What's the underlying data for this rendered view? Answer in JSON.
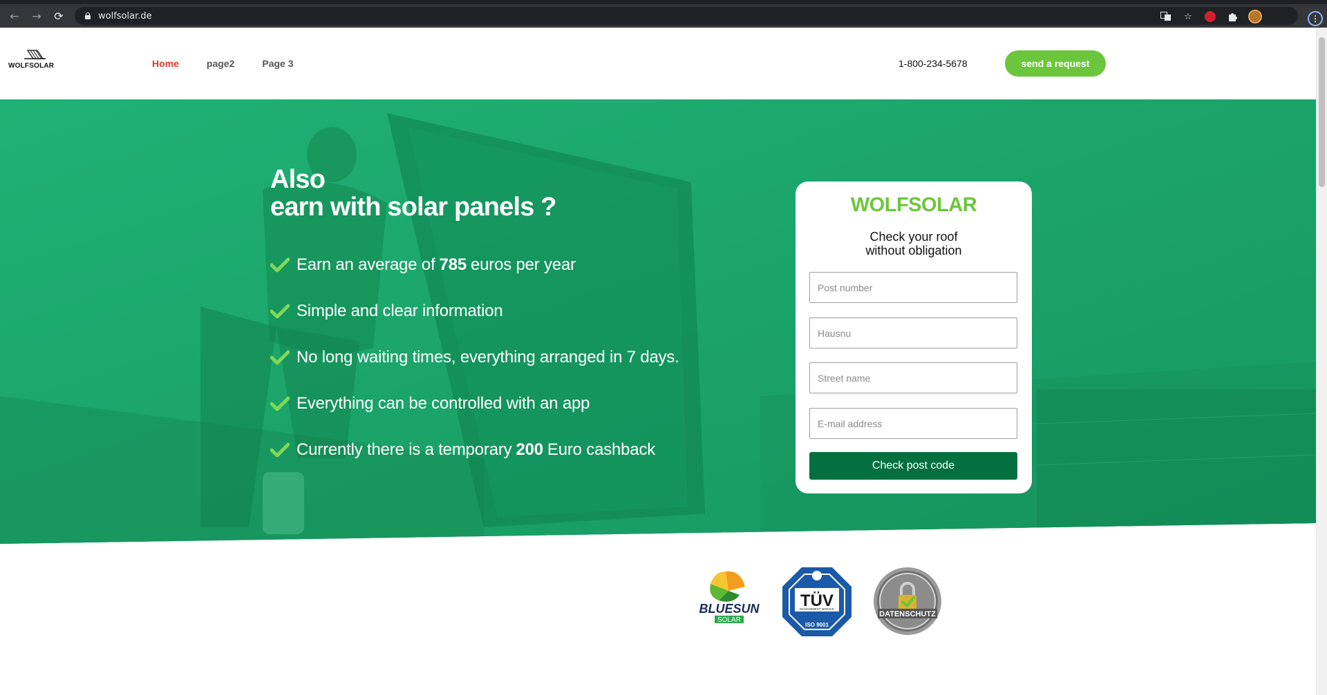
{
  "browser": {
    "url": "wolfsolar.de",
    "icons": [
      "back-arrow-icon",
      "forward-arrow-icon",
      "reload-icon",
      "lock-icon",
      "translate-icon",
      "star-icon",
      "extension-icon",
      "puzzle-icon",
      "profile-avatar",
      "menu-icon"
    ]
  },
  "header": {
    "logo_text": "WOLFSOLAR",
    "nav": [
      {
        "label": "Home",
        "active": true
      },
      {
        "label": "page2",
        "active": false
      },
      {
        "label": "Page 3",
        "active": false
      }
    ],
    "phone": "1-800-234-5678",
    "cta_label": "send a request"
  },
  "hero": {
    "title_line1": "Also",
    "title_line2": "earn with solar panels ?",
    "features": [
      {
        "pre": "Earn an average of",
        "bold": "785",
        "post": "euros per year"
      },
      {
        "pre": "Simple and clear information",
        "bold": "",
        "post": ""
      },
      {
        "pre": "No long waiting times, everything arranged in 7 days.",
        "bold": "",
        "post": ""
      },
      {
        "pre": "Everything can be controlled with an app",
        "bold": "",
        "post": ""
      },
      {
        "pre": "Currently there is a temporary",
        "bold": "200",
        "post": "Euro cashback"
      }
    ]
  },
  "form": {
    "brand": "WOLFSOLAR",
    "subtitle_line1": "Check your roof",
    "subtitle_line2": "without obligation",
    "fields": [
      {
        "placeholder": "Post number",
        "value": ""
      },
      {
        "placeholder": "Hausnu",
        "value": ""
      },
      {
        "placeholder": "Street name",
        "value": ""
      },
      {
        "placeholder": "E-mail address",
        "value": ""
      }
    ],
    "submit_label": "Check post code"
  },
  "badges": {
    "bluesun_line1": "BLUESUN",
    "bluesun_line2": "SOLAR",
    "tuv_brand": "TÜV",
    "tuv_service": "MANAGEMENT SERVICE",
    "tuv_iso": "ISO 9001",
    "datenschutz": "DATENSCHUTZ"
  },
  "colors": {
    "brand_green": "#6cc63c",
    "hero_green": "#1aa46b",
    "button_dark_green": "#05703f",
    "nav_active": "#e0362c"
  }
}
